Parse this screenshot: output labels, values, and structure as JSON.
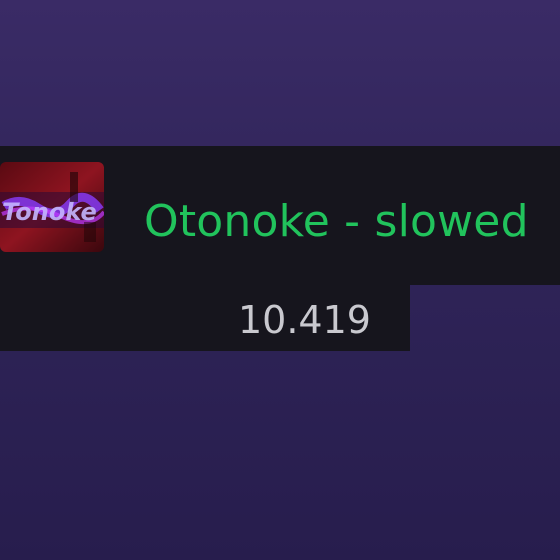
{
  "track": {
    "title": "Otonoke - slowed",
    "cover_icon": "album-art-image",
    "cover_art_text": "Otonoke"
  },
  "stats": {
    "count": "10.419"
  },
  "colors": {
    "background_top": "#3a2b66",
    "background_bottom": "#271d4d",
    "row_background": "#16151d",
    "title_green": "#21c35c",
    "count_text": "#c9c9cf"
  }
}
